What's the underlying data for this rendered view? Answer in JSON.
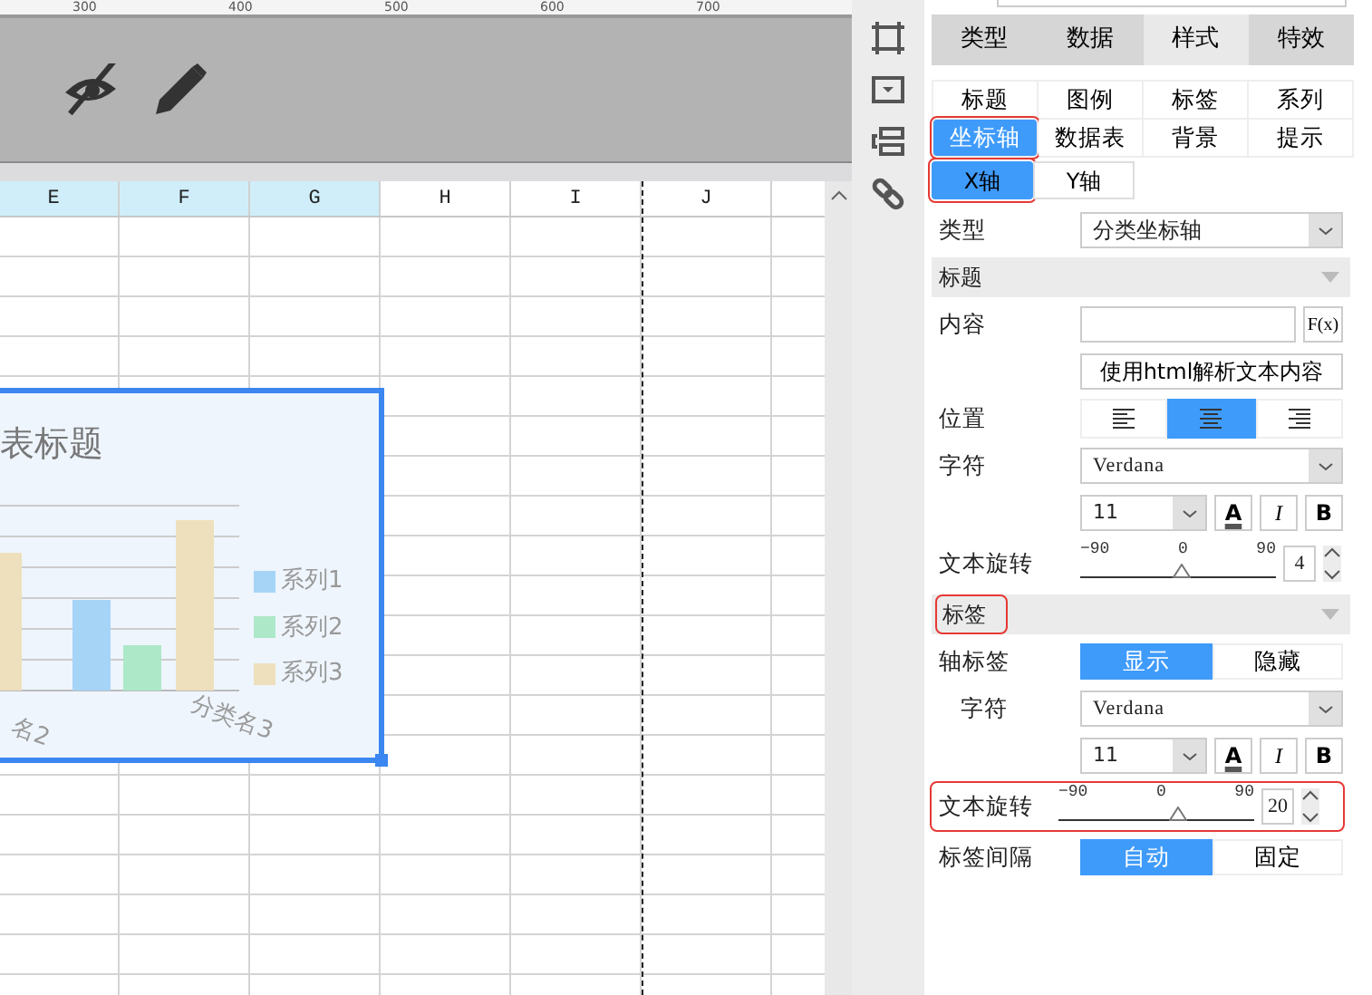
{
  "ruler": {
    "labels": [
      "300",
      "400",
      "500",
      "600",
      "700"
    ]
  },
  "sheet": {
    "columns": [
      {
        "label": "E",
        "selected": true
      },
      {
        "label": "F",
        "selected": true
      },
      {
        "label": "G",
        "selected": true
      },
      {
        "label": "H",
        "selected": false
      },
      {
        "label": "I",
        "selected": false
      },
      {
        "label": "J",
        "selected": false
      }
    ],
    "chart": {
      "title": "表标题",
      "categories": [
        "名2",
        "分类名3"
      ],
      "legend": [
        {
          "label": "系列1",
          "color": "#a6d4f7"
        },
        {
          "label": "系列2",
          "color": "#ade8c8"
        },
        {
          "label": "系列3",
          "color": "#eee0bd"
        }
      ]
    }
  },
  "panel": {
    "tabs": [
      {
        "label": "类型",
        "selected": false
      },
      {
        "label": "数据",
        "selected": false
      },
      {
        "label": "样式",
        "selected": true
      },
      {
        "label": "特效",
        "selected": false
      }
    ],
    "subtabs": [
      {
        "label": "标题",
        "selected": false,
        "highlighted": false
      },
      {
        "label": "图例",
        "selected": false,
        "highlighted": false
      },
      {
        "label": "标签",
        "selected": false,
        "highlighted": false
      },
      {
        "label": "系列",
        "selected": false,
        "highlighted": false
      },
      {
        "label": "坐标轴",
        "selected": true,
        "highlighted": true
      },
      {
        "label": "数据表",
        "selected": false,
        "highlighted": false
      },
      {
        "label": "背景",
        "selected": false,
        "highlighted": false
      },
      {
        "label": "提示",
        "selected": false,
        "highlighted": false
      }
    ],
    "axis_tabs": [
      {
        "label": "X轴",
        "selected": true
      },
      {
        "label": "Y轴",
        "selected": false
      }
    ],
    "rows": [
      {
        "kind": "select",
        "label": "类型",
        "value": "分类坐标轴",
        "highlighted": false
      },
      {
        "kind": "section",
        "label": "标题",
        "highlighted": false
      },
      {
        "kind": "input",
        "label": "内容",
        "button": "F(x)",
        "highlighted": false
      },
      {
        "kind": "button",
        "label": "使用html解析文本内容",
        "highlighted": false
      },
      {
        "kind": "align",
        "label": "位置",
        "options": [
          {
            "kind": "left",
            "selected": false
          },
          {
            "kind": "center",
            "selected": true
          },
          {
            "kind": "right",
            "selected": false
          }
        ],
        "highlighted": false
      },
      {
        "kind": "select",
        "label": "字符",
        "value": "Verdana",
        "highlighted": false
      },
      {
        "kind": "font",
        "size": "11",
        "buttons": [
          {
            "kind": "color",
            "label": "A"
          },
          {
            "kind": "italic",
            "label": "I"
          },
          {
            "kind": "bold",
            "label": "B"
          }
        ],
        "highlighted": false
      },
      {
        "kind": "slider",
        "label": "文本旋转",
        "ticks": [
          "−90",
          "0",
          "90"
        ],
        "level": 0.52,
        "value": "4",
        "highlighted": false
      },
      {
        "kind": "section",
        "label": "标签",
        "highlighted": true
      },
      {
        "kind": "toggle",
        "label": "轴标签",
        "options": [
          {
            "label": "显示",
            "selected": true
          },
          {
            "label": "隐藏",
            "selected": false
          }
        ],
        "highlighted": false,
        "children": [
          {
            "kind": "select",
            "label": "字符",
            "value": "Verdana",
            "highlighted": false
          },
          {
            "kind": "font",
            "size": "11",
            "buttons": [
              {
                "kind": "color",
                "label": "A"
              },
              {
                "kind": "italic",
                "label": "I"
              },
              {
                "kind": "bold",
                "label": "B"
              }
            ],
            "highlighted": false
          },
          {
            "kind": "slider",
            "label": "文本旋转",
            "ticks": [
              "−90",
              "0",
              "90"
            ],
            "level": 0.61,
            "value": "20",
            "highlighted": true
          }
        ]
      },
      {
        "kind": "toggle",
        "label": "标签间隔",
        "options": [
          {
            "label": "自动",
            "selected": true
          },
          {
            "label": "固定",
            "selected": false
          }
        ],
        "highlighted": false
      }
    ]
  }
}
